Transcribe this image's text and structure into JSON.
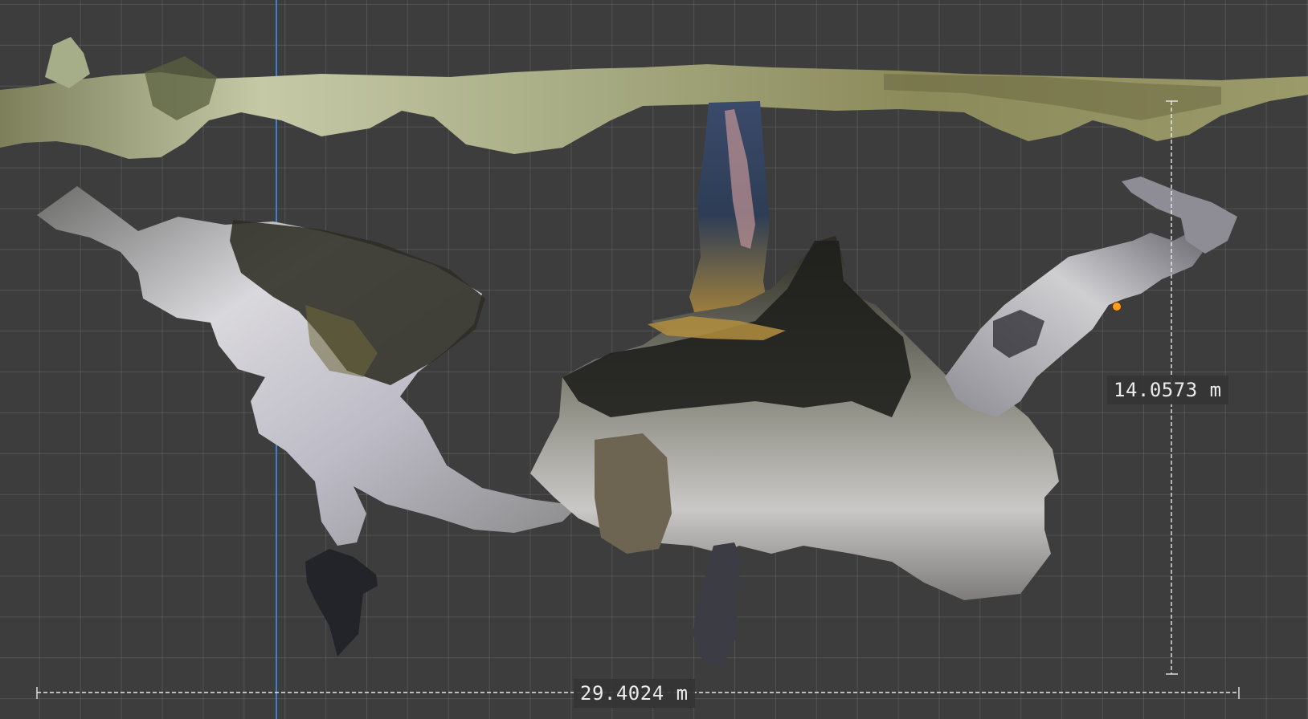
{
  "viewport": {
    "grid_color": "#5a5a5a",
    "background_color": "#3d3d3d",
    "axis_color": "#3f7fd0",
    "selected_vertex_color": "#ff9c20"
  },
  "measurements": {
    "width": "29.4024 m",
    "height": "14.0573 m"
  }
}
